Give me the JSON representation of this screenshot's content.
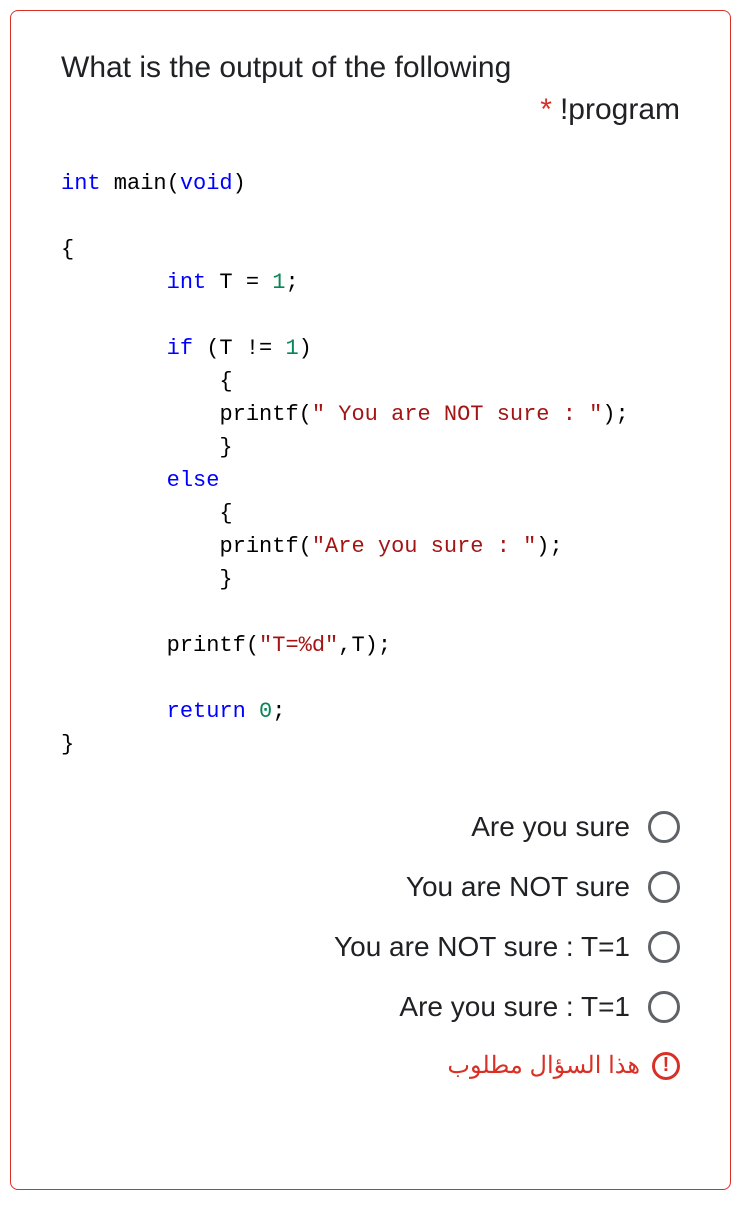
{
  "question": {
    "line1": "What is the output of the following",
    "line2": "!program",
    "asterisk": "*"
  },
  "code": {
    "l1_kw": "int",
    "l1_main": " main(",
    "l1_void": "void",
    "l1_end": ")",
    "l2": "{",
    "l3_indent": "        ",
    "l3_int": "int",
    "l3_rest": " T = ",
    "l3_num": "1",
    "l3_semi": ";",
    "l4_indent": "        ",
    "l4_if": "if",
    "l4_rest": " (T != ",
    "l4_num": "1",
    "l4_end": ")",
    "l5": "            {",
    "l6_indent": "            ",
    "l6_printf": "printf(",
    "l6_str": "\" You are NOT sure : \"",
    "l6_end": ");",
    "l7": "            }",
    "l8_indent": "        ",
    "l8_else": "else",
    "l9": "            {",
    "l10_indent": "            ",
    "l10_printf": "printf(",
    "l10_str": "\"Are you sure : \"",
    "l10_end": ");",
    "l11": "            }",
    "l12_indent": "        ",
    "l12_printf": "printf(",
    "l12_str": "\"T=%d\"",
    "l12_rest": ",T);",
    "l13_indent": "        ",
    "l13_return": "return",
    "l13_sp": " ",
    "l13_num": "0",
    "l13_semi": ";",
    "l14": "}"
  },
  "options": [
    {
      "label": "Are you sure"
    },
    {
      "label": "You are NOT sure"
    },
    {
      "label": "You are NOT sure : T=1"
    },
    {
      "label": "Are you sure : T=1"
    }
  ],
  "required": {
    "text": "هذا السؤال مطلوب",
    "icon": "!"
  }
}
